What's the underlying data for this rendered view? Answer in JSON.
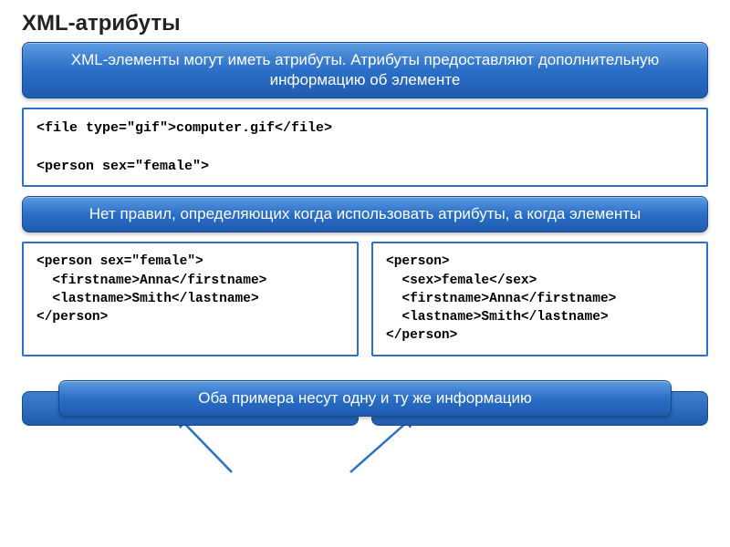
{
  "title": "XML-атрибуты",
  "intro": "XML-элементы могут иметь атрибуты. Атрибуты предоставляют дополнительную информацию об элементе",
  "code1": "<file type=\"gif\">computer.gif</file>\n\n<person sex=\"female\">",
  "mid": "Нет правил, определяющих когда использовать атрибуты, а когда элементы",
  "codeLeft": "<person sex=\"female\">\n  <firstname>Anna</firstname>\n  <lastname>Smith</lastname>\n</person>",
  "codeRight": "<person>\n  <sex>female</sex>\n  <firstname>Anna</firstname>\n  <lastname>Smith</lastname>\n</person>",
  "bottom": "Оба примера несут одну и ту же информацию"
}
